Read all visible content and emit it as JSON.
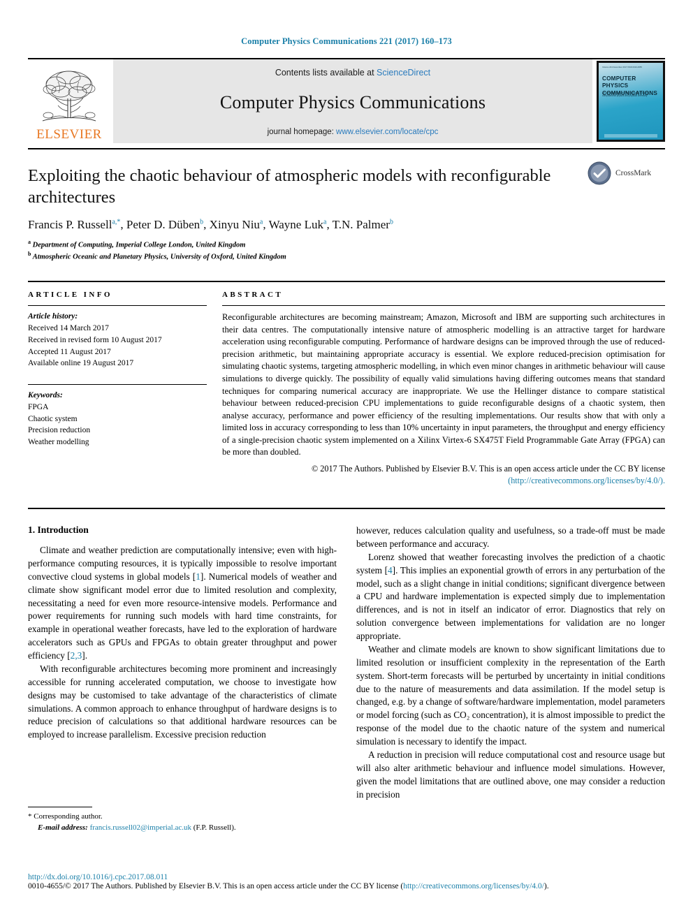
{
  "running_head": "Computer Physics Communications 221 (2017) 160–173",
  "masthead": {
    "publisher_name": "ELSEVIER",
    "contents_prefix": "Contents lists available at ",
    "contents_link": "ScienceDirect",
    "journal_title": "Computer Physics Communications",
    "homepage_prefix": "journal homepage: ",
    "homepage_link": "www.elsevier.com/locate/cpc",
    "cover": {
      "title_line1": "COMPUTER PHYSICS",
      "title_line2": "COMMUNICATIONS",
      "subtitle": "An international journal and program library for computational physics and physical chemistry",
      "top_left": "Volume 221  December 2017  ISSN 0010-4655",
      "top_right": "ISSN 0010-4655"
    }
  },
  "article": {
    "title": "Exploiting the chaotic behaviour of atmospheric models with reconfigurable architectures",
    "authors": [
      {
        "name": "Francis P. Russell",
        "marks": "a,*"
      },
      {
        "name": "Peter D. Düben",
        "marks": "b"
      },
      {
        "name": "Xinyu Niu",
        "marks": "a"
      },
      {
        "name": "Wayne Luk",
        "marks": "a"
      },
      {
        "name": "T.N. Palmer",
        "marks": "b"
      }
    ],
    "affiliations": [
      {
        "mark": "a",
        "text": "Department of Computing, Imperial College London, United Kingdom"
      },
      {
        "mark": "b",
        "text": "Atmospheric Oceanic and Planetary Physics, University of Oxford, United Kingdom"
      }
    ],
    "crossmark_label": "CrossMark"
  },
  "article_info": {
    "heading": "ARTICLE INFO",
    "history_label": "Article history:",
    "history": [
      "Received 14 March 2017",
      "Received in revised form 10 August 2017",
      "Accepted 11 August 2017",
      "Available online 19 August 2017"
    ],
    "keywords_label": "Keywords:",
    "keywords": [
      "FPGA",
      "Chaotic system",
      "Precision reduction",
      "Weather modelling"
    ]
  },
  "abstract": {
    "heading": "ABSTRACT",
    "text": "Reconfigurable architectures are becoming mainstream; Amazon, Microsoft and IBM are supporting such architectures in their data centres. The computationally intensive nature of atmospheric modelling is an attractive target for hardware acceleration using reconfigurable computing. Performance of hardware designs can be improved through the use of reduced-precision arithmetic, but maintaining appropriate accuracy is essential. We explore reduced-precision optimisation for simulating chaotic systems, targeting atmospheric modelling, in which even minor changes in arithmetic behaviour will cause simulations to diverge quickly. The possibility of equally valid simulations having differing outcomes means that standard techniques for comparing numerical accuracy are inappropriate. We use the Hellinger distance to compare statistical behaviour between reduced-precision CPU implementations to guide reconfigurable designs of a chaotic system, then analyse accuracy, performance and power efficiency of the resulting implementations. Our results show that with only a limited loss in accuracy corresponding to less than 10% uncertainty in input parameters, the throughput and energy efficiency of a single-precision chaotic system implemented on a Xilinx Virtex-6 SX475T Field Programmable Gate Array (FPGA) can be more than doubled.",
    "copyright_text": "© 2017 The Authors. Published by Elsevier B.V. This is an open access article under the CC BY license",
    "license_url": "(http://creativecommons.org/licenses/by/4.0/)."
  },
  "body": {
    "section_number_title": "1. Introduction",
    "left_paragraphs": [
      {
        "pre": "Climate and weather prediction are computationally intensive; even with high-performance computing resources, it is typically impossible to resolve important convective cloud systems in global models [",
        "cite": "1",
        "post": "]. Numerical models of weather and climate show significant model error due to limited resolution and complexity, necessitating a need for even more resource-intensive models. Performance and power requirements for running such models with hard time constraints, for example in operational weather forecasts, have led to the exploration of hardware accelerators such as GPUs and FPGAs to obtain greater throughput and power efficiency [",
        "cite2": "2,3",
        "post2": "]."
      },
      {
        "pre": "With reconfigurable architectures becoming more prominent and increasingly accessible for running accelerated computation, we choose to investigate how designs may be customised to take advantage of the characteristics of climate simulations. A common approach to enhance throughput of hardware designs is to reduce precision of calculations so that additional hardware resources can be employed to increase parallelism. Excessive precision reduction",
        "cite": "",
        "post": ""
      }
    ],
    "right_paragraphs": [
      {
        "pre": "however, reduces calculation quality and usefulness, so a trade-off must be made between performance and accuracy.",
        "cite": "",
        "post": ""
      },
      {
        "pre": "Lorenz showed that weather forecasting involves the prediction of a chaotic system [",
        "cite": "4",
        "post": "]. This implies an exponential growth of errors in any perturbation of the model, such as a slight change in initial conditions; significant divergence between a CPU and hardware implementation is expected simply due to implementation differences, and is not in itself an indicator of error. Diagnostics that rely on solution convergence between implementations for validation are no longer appropriate."
      },
      {
        "pre": "Weather and climate models are known to show significant limitations due to limited resolution or insufficient complexity in the representation of the Earth system. Short-term forecasts will be perturbed by uncertainty in initial conditions due to the nature of measurements and data assimilation. If the model setup is changed, e.g. by a change of software/hardware implementation, model parameters or model forcing (such as CO₂ concentration), it is almost impossible to predict the response of the model due to the chaotic nature of the system and numerical simulation is necessary to identify the impact.",
        "cite": "",
        "post": ""
      },
      {
        "pre": "A reduction in precision will reduce computational cost and resource usage but will also alter arithmetic behaviour and influence model simulations. However, given the model limitations that are outlined above, one may consider a reduction in precision",
        "cite": "",
        "post": ""
      }
    ]
  },
  "footnote": {
    "corresponding_marker": "*",
    "corresponding_text": "Corresponding author.",
    "email_label": "E-mail address:",
    "email": "francis.russell02@imperial.ac.uk",
    "email_suffix": "(F.P. Russell)."
  },
  "page_footer": {
    "doi": "http://dx.doi.org/10.1016/j.cpc.2017.08.011",
    "issn_prefix": "0010-4655/© 2017 The Authors. Published by Elsevier B.V. This is an open access article under the CC BY license (",
    "issn_link": "http://creativecommons.org/licenses/by/4.0/",
    "issn_suffix": ")."
  },
  "colors": {
    "link": "#1a7fa8",
    "elsevier_orange": "#E87722",
    "cover_teal": "#2ba4c9"
  }
}
